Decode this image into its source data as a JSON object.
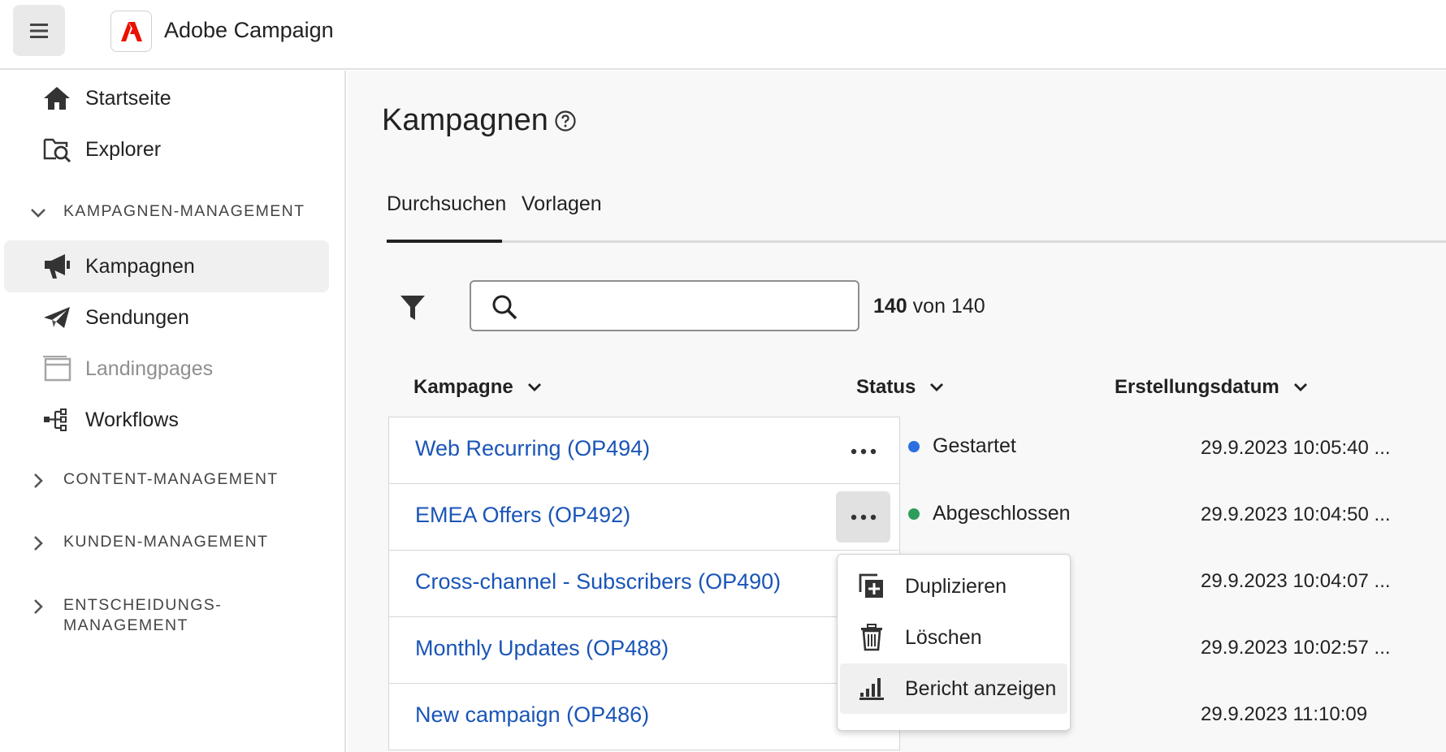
{
  "app": {
    "title": "Adobe Campaign",
    "brand_color": "#EB1000"
  },
  "sidebar": {
    "items": [
      {
        "label": "Startseite",
        "icon": "home-icon"
      },
      {
        "label": "Explorer",
        "icon": "explorer-icon"
      },
      {
        "label": "Kampagnen",
        "icon": "megaphone-icon",
        "active": true
      },
      {
        "label": "Sendungen",
        "icon": "paper-plane-icon"
      },
      {
        "label": "Landingpages",
        "icon": "landing-page-icon",
        "disabled": true
      },
      {
        "label": "Workflows",
        "icon": "workflow-icon"
      }
    ],
    "sections": [
      {
        "label": "KAMPAGNEN-MANAGEMENT",
        "expanded": true
      },
      {
        "label": "CONTENT-MANAGEMENT",
        "expanded": false
      },
      {
        "label": "KUNDEN-MANAGEMENT",
        "expanded": false
      },
      {
        "label": "ENTSCHEIDUNGS-",
        "label2": "MANAGEMENT",
        "expanded": false
      }
    ]
  },
  "main": {
    "title": "Kampagnen",
    "tabs": [
      {
        "label": "Durchsuchen",
        "active": true
      },
      {
        "label": "Vorlagen"
      }
    ],
    "search": {
      "value": "",
      "placeholder": ""
    },
    "count": {
      "shown": "140",
      "text": "von 140"
    },
    "columns": [
      "Kampagne",
      "Status",
      "Erstellungsdatum"
    ],
    "rows": [
      {
        "name": "Web Recurring (OP494)",
        "status": "Gestartet",
        "status_color": "#2C6FE0",
        "date": "29.9.2023 10:05:40 ..."
      },
      {
        "name": "EMEA Offers (OP492)",
        "status": "Abgeschlossen",
        "status_color": "#2D9D5E",
        "date": "29.9.2023 10:04:50 ..."
      },
      {
        "name": "Cross-channel - Subscribers (OP490)",
        "status": "",
        "date": "29.9.2023 10:04:07 ..."
      },
      {
        "name": "Monthly Updates (OP488)",
        "status": "",
        "date": "29.9.2023 10:02:57 ..."
      },
      {
        "name": "New campaign (OP486)",
        "status": "",
        "date": "29.9.2023 11:10:09"
      }
    ],
    "context_menu": [
      {
        "label": "Duplizieren",
        "icon": "duplicate-icon"
      },
      {
        "label": "Löschen",
        "icon": "trash-icon"
      },
      {
        "label": "Bericht anzeigen",
        "icon": "report-chart-icon",
        "highlighted": true
      }
    ]
  }
}
